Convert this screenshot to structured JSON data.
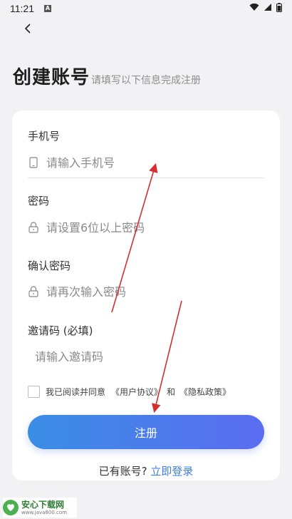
{
  "status_bar": {
    "time": "11:21",
    "badge": "A"
  },
  "header": {
    "title": "创建账号",
    "subtitle": "请填写以下信息完成注册"
  },
  "form": {
    "phone": {
      "label": "手机号",
      "placeholder": "请输入手机号",
      "icon": "phone-icon"
    },
    "password": {
      "label": "密码",
      "placeholder": "请设置6位以上密码",
      "icon": "lock-icon"
    },
    "confirm": {
      "label": "确认密码",
      "placeholder": "请再次输入密码",
      "icon": "lock-icon"
    },
    "invite": {
      "label": "邀请码 (必填)",
      "placeholder": "请输入邀请码"
    }
  },
  "agreement": {
    "prefix": "我已阅读并同意",
    "user_agreement": "《用户协议》",
    "and": "和",
    "privacy_policy": "《隐私政策》",
    "checked": false
  },
  "register_button": "注册",
  "login_prompt": {
    "text": "已有账号?",
    "link": "立即登录"
  },
  "watermark": {
    "title": "安心下载网",
    "url": "www.java800.com"
  },
  "colors": {
    "accent_start": "#3a8ee6",
    "accent_end": "#5b6cf0",
    "link": "#3d7fe0",
    "arrow": "#d32f2f"
  }
}
